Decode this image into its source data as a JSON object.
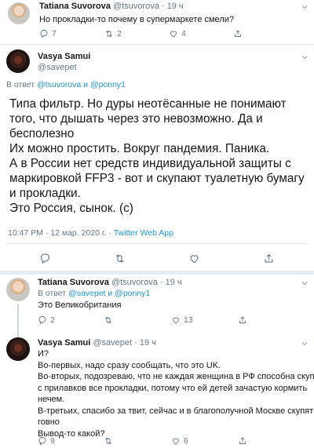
{
  "tweet1": {
    "author_name": "Tatiana Suvorova",
    "author_handle": "@tsuvorova",
    "time": "19 ч",
    "text": "Но прокладки-то почему в супермаркете смели?",
    "replies": "7",
    "retweets": "2",
    "likes": "4"
  },
  "main_tweet": {
    "author_name": "Vasya Samui",
    "author_handle": "@savepet",
    "reply_prefix": "В ответ",
    "reply_to": "@tsuvorova и @ponny1",
    "lines": [
      "Типа фильтр. Но дуры неотёсанные не понимают",
      "того, что дышать через это невозможно. Да и",
      "бесполезно",
      "Их можно простить. Вокруг пандемия.  Паника.",
      "А в России нет средств индивидуальной защиты с",
      "маркировкой FFP3 - вот и скупают туалетную бумагу",
      "и прокладки.",
      "Это Россия, сынок. (с)"
    ],
    "meta_time": "10:47 PM · 12 мар. 2020 г. · ",
    "meta_source": "Twitter Web App"
  },
  "tweet3": {
    "author_name": "Tatiana Suvorova",
    "author_handle": "@tsuvorova",
    "time": "19 ч",
    "reply_prefix": "В ответ",
    "reply_to": "@savepet и @ponny1",
    "text": "Это Великобритания",
    "replies": "2",
    "retweets": "",
    "likes": "13"
  },
  "tweet4": {
    "author_name": "Vasya Samui",
    "author_handle": "@savepet",
    "time": "19 ч",
    "lines": [
      "И?",
      "Во-первых, надо сразу сообщать, что это  UK.",
      "Во-вторых, подозреваю, что не каждая женщина в РФ способна скупить",
      "с прилавков все прокладки, потому что ей детей зачастую кормить",
      "нечем.",
      "В-третьих, спасибо за твит, сейчас и в благополучной Москве скупят это",
      "говно",
      "Вывод-то какой?"
    ],
    "replies": "9",
    "retweets": "",
    "likes": "6"
  },
  "colors": {
    "accent": "#1b95e0",
    "muted": "#657786",
    "divider": "#e1e8ed"
  }
}
